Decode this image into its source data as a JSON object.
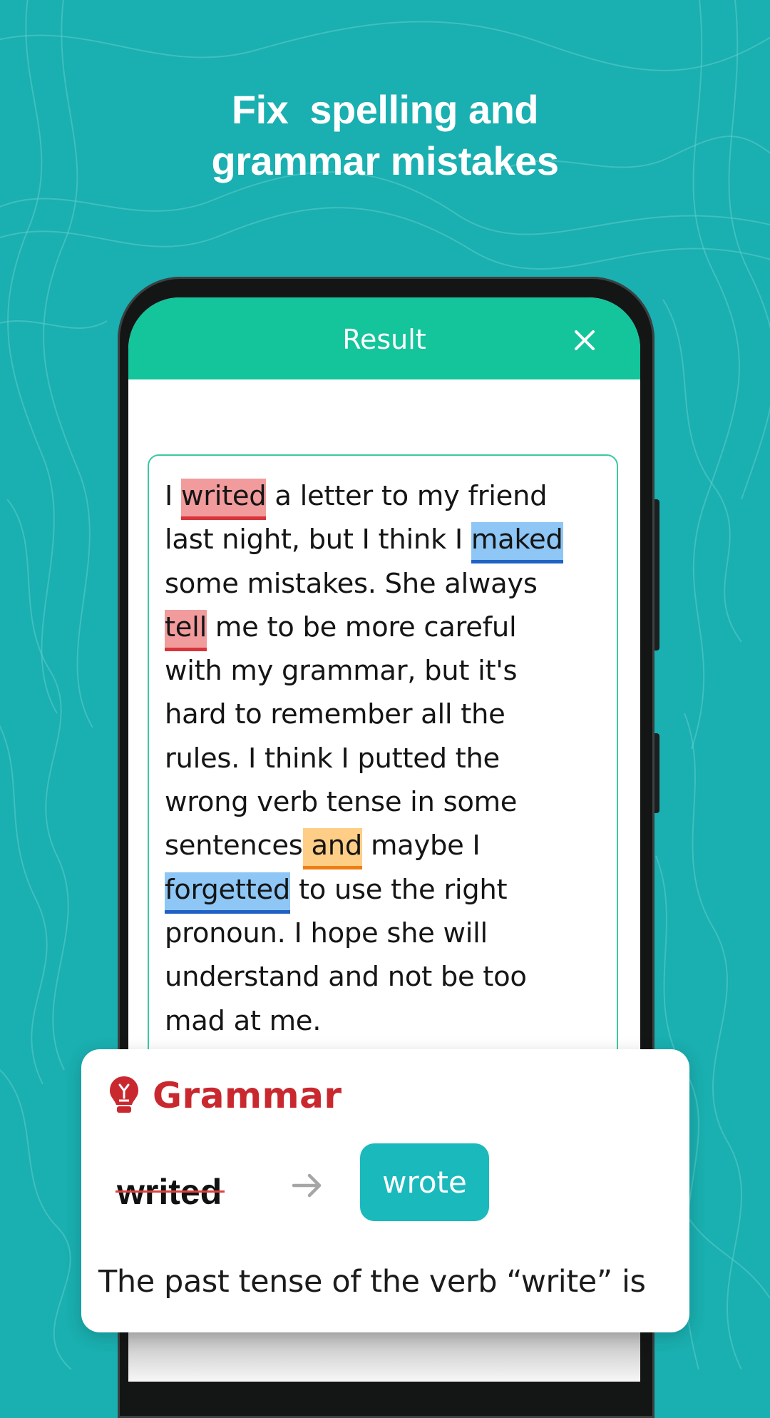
{
  "headline": {
    "line1": "Fix  spelling and",
    "line2": "grammar mistakes"
  },
  "colors": {
    "background": "#1aafb0",
    "header": "#14c49b",
    "spelling_highlight": "#f19b9c",
    "grammar_highlight": "#8ec6f5",
    "style_highlight": "#ffce86",
    "grammar_label": "#c9282f",
    "suggestion_button": "#1ab9bc"
  },
  "app": {
    "title": "Result",
    "close_icon": "close-icon"
  },
  "passage": {
    "lines": [
      [
        {
          "t": "I "
        },
        {
          "t": "writed",
          "hl": "red"
        },
        {
          "t": " a letter to my friend"
        }
      ],
      [
        {
          "t": "last night, but I think I "
        },
        {
          "t": "maked",
          "hl": "blue"
        }
      ],
      [
        {
          "t": "some mistakes. She always"
        }
      ],
      [
        {
          "t": "tell",
          "hl": "red"
        },
        {
          "t": " me to be more careful"
        }
      ],
      [
        {
          "t": "with my grammar, but it's"
        }
      ],
      [
        {
          "t": "hard to remember all the"
        }
      ],
      [
        {
          "t": "rules. I think I putted the"
        }
      ],
      [
        {
          "t": "wrong verb tense in some"
        }
      ],
      [
        {
          "t": "sentences"
        },
        {
          "t": " and",
          "hl": "orange"
        },
        {
          "t": " maybe I"
        }
      ],
      [
        {
          "t": "forgetted",
          "hl": "blue"
        },
        {
          "t": " to use the right"
        }
      ],
      [
        {
          "t": "pronoun. I hope she will"
        }
      ],
      [
        {
          "t": "understand and not be too"
        }
      ],
      [
        {
          "t": "mad at me."
        }
      ]
    ]
  },
  "card": {
    "icon": "lightbulb-icon",
    "type_label": "Grammar",
    "wrong_word": "writed",
    "arrow_icon": "arrow-right-icon",
    "suggestion": "wrote",
    "explanation": "The past tense of the verb “write” is"
  }
}
